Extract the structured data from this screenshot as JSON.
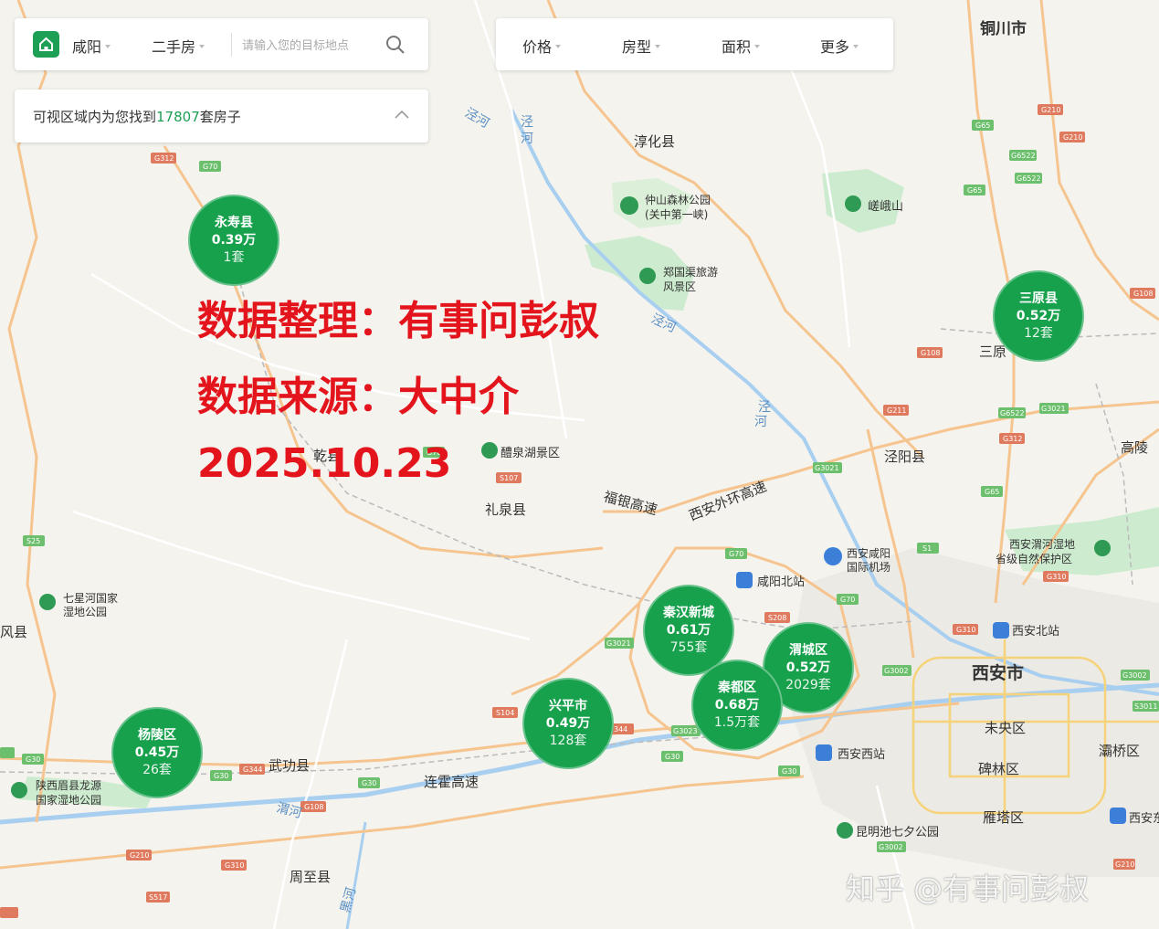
{
  "search": {
    "city": "咸阳",
    "category": "二手房",
    "placeholder": "请输入您的目标地点"
  },
  "filters": [
    "价格",
    "房型",
    "面积",
    "更多"
  ],
  "result": {
    "prefix": "可视区域内为您找到",
    "count": "17807",
    "suffix": "套房子"
  },
  "clusters": [
    {
      "name": "永寿县",
      "price": "0.39万",
      "count": "1套"
    },
    {
      "name": "三原县",
      "price": "0.52万",
      "count": "12套"
    },
    {
      "name": "秦汉新城",
      "price": "0.61万",
      "count": "755套"
    },
    {
      "name": "渭城区",
      "price": "0.52万",
      "count": "2029套"
    },
    {
      "name": "秦都区",
      "price": "0.68万",
      "count": "1.5万套"
    },
    {
      "name": "兴平市",
      "price": "0.49万",
      "count": "128套"
    },
    {
      "name": "杨陵区",
      "price": "0.45万",
      "count": "26套"
    }
  ],
  "overlay": {
    "line1": "数据整理：有事问彭叔",
    "line2": "数据来源：大中介",
    "line3": "2025.10.23"
  },
  "watermark": "知乎 @有事问彭叔",
  "map": {
    "places": [
      "铜川市",
      "淳化县",
      "仲山森林公园",
      "(关中第一峡)",
      "嵯峨山",
      "郑国渠旅游",
      "风景区",
      "三原",
      "泾阳县",
      "高陵",
      "乾县",
      "醴泉湖景区",
      "礼泉县",
      "西安咸阳",
      "国际机场",
      "咸阳北站",
      "西安渭河湿地",
      "省级自然保护区",
      "七星河国家",
      "湿地公园",
      "风县",
      "西安北站",
      "西安市",
      "未央区",
      "灞桥区",
      "碑林区",
      "雁塔区",
      "西安西站",
      "昆明池七夕公园",
      "武功县",
      "陕西眉县龙源",
      "国家湿地公园",
      "周至县",
      "西安东"
    ],
    "roads": [
      "福银高速",
      "西安外环高速",
      "连霍高速",
      "泾河",
      "渭河",
      "黑河",
      "G312",
      "G70",
      "G65",
      "G210",
      "G6522",
      "G108",
      "G211",
      "G3021",
      "G3002",
      "G310",
      "G30",
      "G344",
      "S107",
      "S104",
      "S208",
      "S1",
      "S25",
      "S517"
    ]
  },
  "colors": {
    "brand": "#1da056",
    "cluster": "#18a14d",
    "overlay_text": "#e3141c",
    "highway": "#f6c48e",
    "water": "#a9cff0",
    "park": "#bfe6c9"
  }
}
